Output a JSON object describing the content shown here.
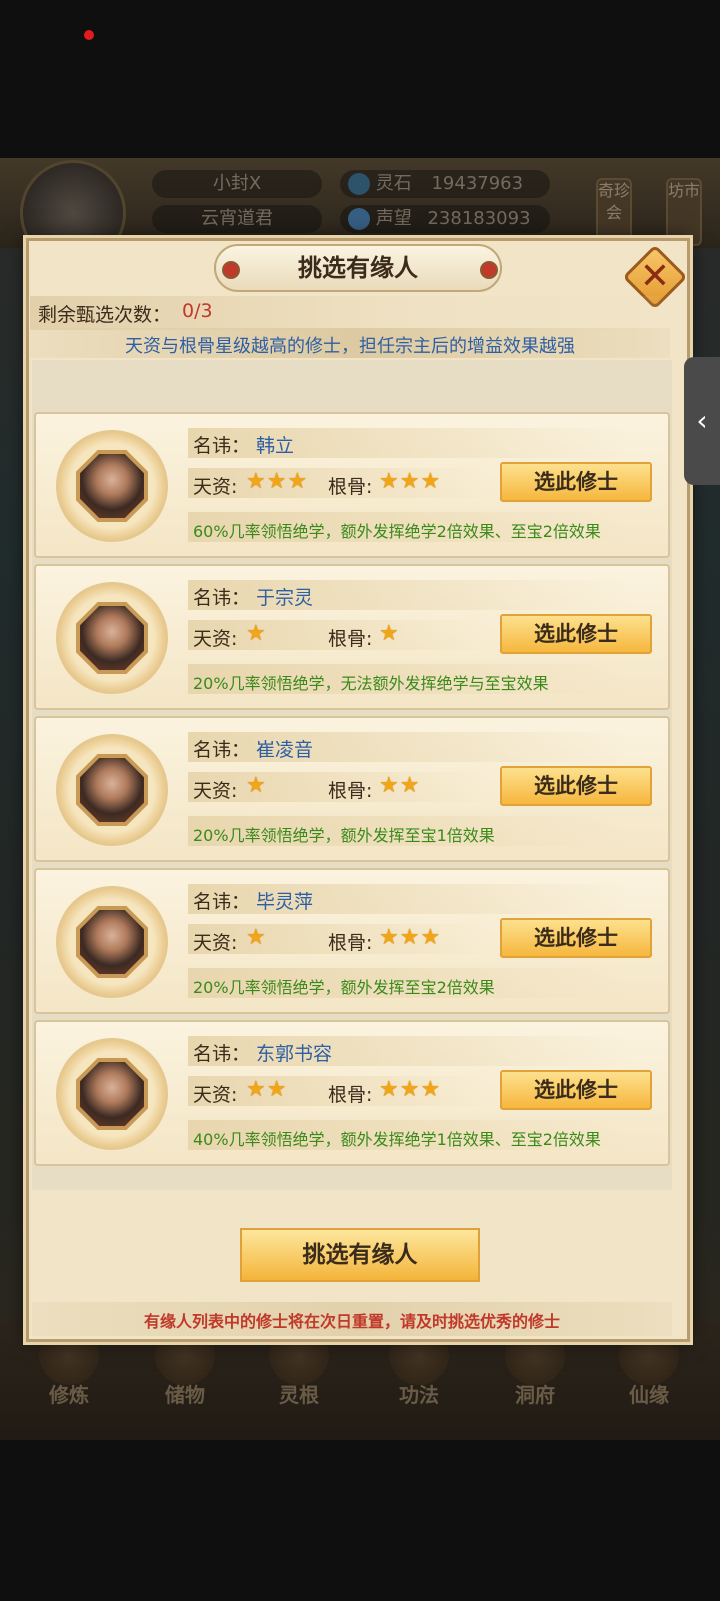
{
  "top_bar": {
    "player_name": "小封X",
    "player_title": "云宵道君",
    "spirit_stone_label": "灵石",
    "spirit_stone_value": "19437963",
    "prestige_label": "声望",
    "prestige_value": "238183093",
    "side_tag_1": "奇珍会",
    "side_tag_2": "坊市"
  },
  "bottom_nav": [
    {
      "label": "修炼",
      "icon": "cultivate-icon"
    },
    {
      "label": "储物",
      "icon": "storage-bag-icon"
    },
    {
      "label": "灵根",
      "icon": "spirit-root-icon"
    },
    {
      "label": "功法",
      "icon": "scroll-icon"
    },
    {
      "label": "洞府",
      "icon": "cave-dwelling-icon"
    },
    {
      "label": "仙缘",
      "icon": "immortal-fate-icon"
    }
  ],
  "dialog": {
    "title": "挑选有缘人",
    "close_icon": "close-icon",
    "remaining_label": "剩余甄选次数：",
    "remaining_value": "0/3",
    "hint": "天资与根骨星级越高的修士，担任宗主后的增益效果越强",
    "name_label": "名讳：",
    "talent_label": "天资:",
    "bone_label": "根骨:",
    "pick_label": "选此修士",
    "candidates": [
      {
        "name": "韩立",
        "talent_stars": 3,
        "bone_stars": 3,
        "effect": "60%几率领悟绝学，额外发挥绝学2倍效果、至宝2倍效果"
      },
      {
        "name": "于宗灵",
        "talent_stars": 1,
        "bone_stars": 1,
        "effect": "20%几率领悟绝学，无法额外发挥绝学与至宝效果"
      },
      {
        "name": "崔凌音",
        "talent_stars": 1,
        "bone_stars": 2,
        "effect": "20%几率领悟绝学，额外发挥至宝1倍效果"
      },
      {
        "name": "毕灵萍",
        "talent_stars": 1,
        "bone_stars": 3,
        "effect": "20%几率领悟绝学，额外发挥至宝2倍效果"
      },
      {
        "name": "东郭书容",
        "talent_stars": 2,
        "bone_stars": 3,
        "effect": "40%几率领悟绝学，额外发挥绝学1倍效果、至宝2倍效果"
      }
    ],
    "choose_button": "挑选有缘人",
    "footer": "有缘人列表中的修士将在次日重置，请及时挑选优秀的修士",
    "star_color": "#f2a516",
    "name_color": "#2f5fa3",
    "effect_color": "#3a8a1a",
    "footer_color": "#c0392b"
  }
}
